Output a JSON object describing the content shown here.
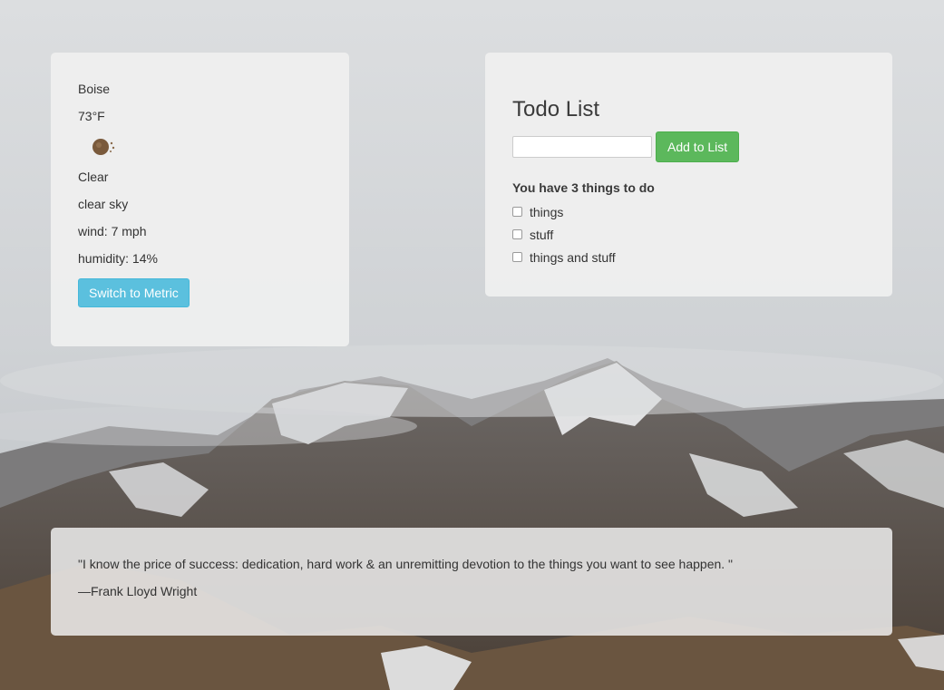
{
  "weather": {
    "city": "Boise",
    "temperature": "73°F",
    "icon": "clear-sky-icon",
    "condition": "Clear",
    "description": "clear sky",
    "wind": "wind: 7 mph",
    "humidity": "humidity: 14%",
    "toggle_label": "Switch to Metric"
  },
  "todo": {
    "title": "Todo List",
    "input_value": "",
    "add_label": "Add to List",
    "count_text": "You have 3 things to do",
    "items": [
      {
        "label": "things",
        "checked": false
      },
      {
        "label": "stuff",
        "checked": false
      },
      {
        "label": "things and stuff",
        "checked": false
      }
    ]
  },
  "quote": {
    "text": "\"I know the price of success: dedication, hard work & an unremitting devotion to the things you want to see happen. \"",
    "author": "—Frank Lloyd Wright"
  },
  "colors": {
    "info_button": "#5bc0de",
    "success_button": "#5cb85c",
    "panel_bg": "#eeeeee"
  }
}
